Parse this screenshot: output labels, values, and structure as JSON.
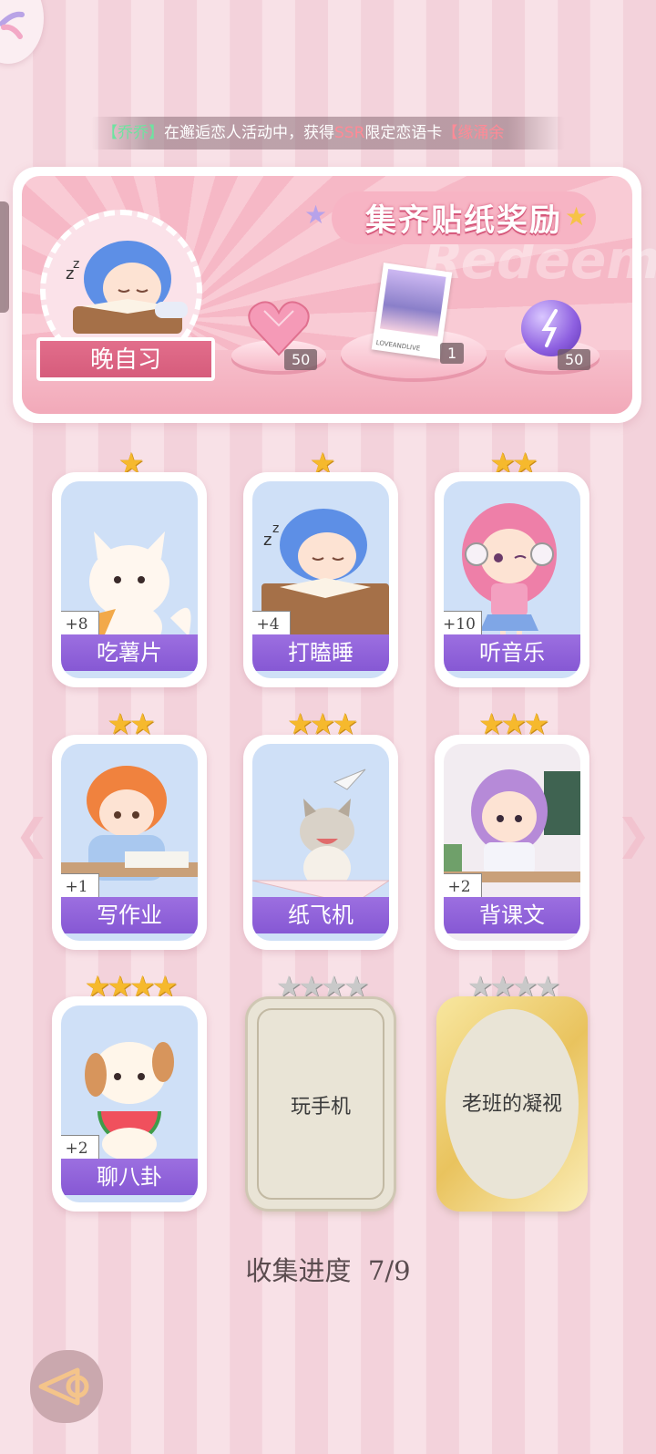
{
  "ticker": {
    "player": "【乔乔】",
    "mid": "在邂逅恋人活动中，获得",
    "rarity": "SSR",
    "tail": "限定恋语卡",
    "item": "【缘涌余"
  },
  "banner": {
    "title": "集齐贴纸奖励",
    "watermark": "Redeem",
    "theme_label": "晚自习",
    "rewards": [
      {
        "icon": "pink-heart-gem-icon",
        "count": "50"
      },
      {
        "icon": "photo-card-icon",
        "count": "1",
        "caption": "LOVEANDLIVE"
      },
      {
        "icon": "purple-orb-icon",
        "count": "50"
      }
    ]
  },
  "cards": [
    {
      "label": "吃薯片",
      "bonus": "+8",
      "stars": 1
    },
    {
      "label": "打瞌睡",
      "bonus": "+4",
      "stars": 1
    },
    {
      "label": "听音乐",
      "bonus": "+10",
      "stars": 2
    },
    {
      "label": "写作业",
      "bonus": "+1",
      "stars": 2
    },
    {
      "label": "纸飞机",
      "bonus": "",
      "stars": 3
    },
    {
      "label": "背课文",
      "bonus": "+2",
      "stars": 3
    },
    {
      "label": "聊八卦",
      "bonus": "+2",
      "stars": 4
    }
  ],
  "locked_cards": [
    {
      "label": "玩手机",
      "stars": 4
    },
    {
      "label": "老班的凝视",
      "stars": 4
    }
  ],
  "progress": {
    "label": "收集进度",
    "value": "7/9"
  },
  "colors": {
    "accent": "#8658d4",
    "ribbon": "#d55a7a",
    "star": "#f6b92d"
  }
}
